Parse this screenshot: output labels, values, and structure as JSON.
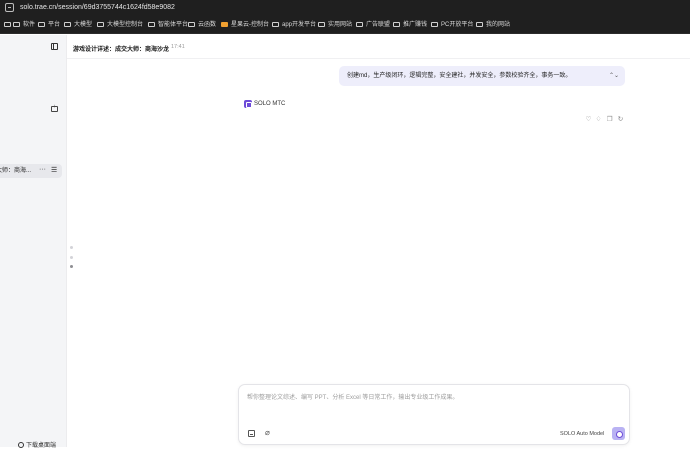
{
  "browser": {
    "url": "solo.trae.cn/session/69d3755744c1624fd58e9082",
    "bookmarks": [
      {
        "label": "软件"
      },
      {
        "label": "平台"
      },
      {
        "label": "大模型"
      },
      {
        "label": "大模型控制台"
      },
      {
        "label": "智能体平台"
      },
      {
        "label": "云函数"
      },
      {
        "label": "星果云-控制台",
        "accent": "#f0a030"
      },
      {
        "label": "app开发平台"
      },
      {
        "label": "实用网站"
      },
      {
        "label": "广告联盟"
      },
      {
        "label": "推广赚钱"
      },
      {
        "label": "PC开放平台"
      },
      {
        "label": "我的网站"
      }
    ]
  },
  "sidebar": {
    "session_label": "成交大师：商海...",
    "more": "···",
    "bottom_link": "下载桌面端"
  },
  "header": {
    "title": "游戏设计详述：成交大师：商海沙龙",
    "time": "17:41"
  },
  "conversation": {
    "user_message": "创建md，生产级闭环，逻辑完整，安全建社，并发安全，参数校验齐全，事务一致。",
    "assistant_name": "SOLO MTC"
  },
  "composer": {
    "placeholder": "帮你整理论文综述、编写 PPT、分析 Excel 等日常工作，输出专业级工作成果。",
    "model_label": "SOLO Auto Model"
  },
  "colors": {
    "brand": "#6d4bd8",
    "user_bubble": "#eeeefb",
    "send_button": "#b9b2f3",
    "browser_bar": "#1f1f1f",
    "sidebar_bg": "#f4f5f7"
  }
}
